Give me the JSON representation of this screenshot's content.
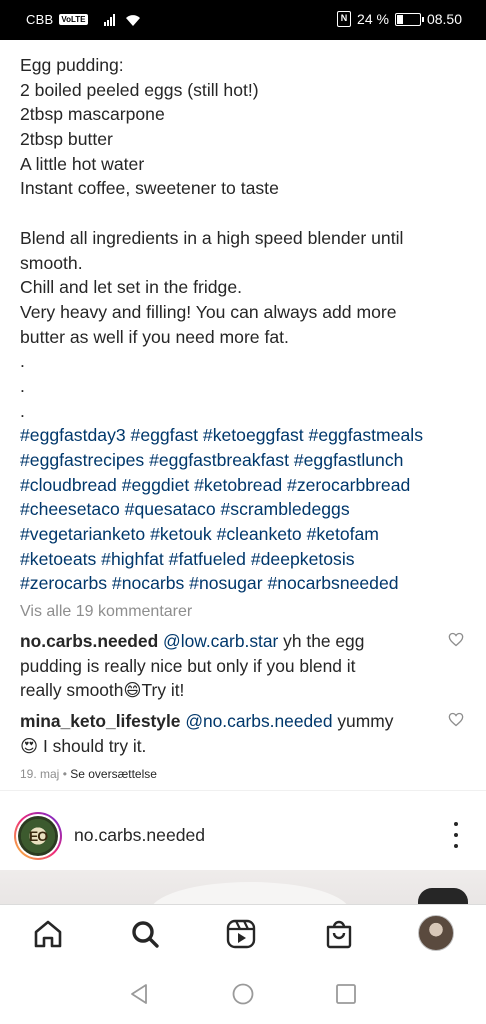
{
  "status_bar": {
    "carrier": "CBB",
    "volte": "VoLTE",
    "battery_percent": "24 %",
    "battery_level": 0.24,
    "time": "08.50"
  },
  "caption": {
    "lines": [
      "Egg pudding:",
      "2 boiled peeled eggs (still hot!)",
      "2tbsp mascarpone",
      "2tbsp butter",
      "A little hot water",
      "Instant coffee, sweetener to taste"
    ],
    "body_lines": [
      "Blend all ingredients in a high speed blender until",
      "smooth.",
      "Chill and let set in the fridge.",
      "Very heavy and filling! You can always add more",
      "butter as well if you need more fat.",
      ".",
      ".",
      "."
    ],
    "hashtag_lines": [
      "#eggfastday3 #eggfast #ketoeggfast #eggfastmeals",
      "#eggfastrecipes #eggfastbreakfast #eggfastlunch",
      "#cloudbread #eggdiet #ketobread #zerocarbbread",
      "#cheesetaco #quesataco #scrambledeggs",
      "#vegetarianketo #ketouk #cleanketo #ketofam",
      "#ketoeats #highfat #fatfueled #deepketosis",
      "#zerocarbs #nocarbs #nosugar #nocarbsneeded"
    ]
  },
  "view_all_comments": "Vis alle 19 kommentarer",
  "comments": [
    {
      "user": "no.carbs.needed",
      "mention": "@low.carb.star",
      "text_line1": " yh the egg",
      "text_line2": "pudding is really nice but only if you blend it",
      "text_line3": "really smooth😄Try it!"
    },
    {
      "user": "mina_keto_lifestyle",
      "mention": "@no.carbs.needed",
      "text_line1": " yummy",
      "text_line2": "😍 I should try it."
    }
  ],
  "post_meta": {
    "date": "19. maj",
    "separator": " • ",
    "translate": "Se oversættelse"
  },
  "next_post": {
    "username": "no.carbs.needed",
    "avatar_text": "EO"
  },
  "tabbar": {
    "icons": [
      "home-icon",
      "search-icon",
      "reels-icon",
      "shop-icon",
      "profile-avatar"
    ]
  },
  "colors": {
    "text": "#262626",
    "hashtag": "#00376b",
    "secondary": "#8e8e8e",
    "status_bar": "#000000"
  }
}
